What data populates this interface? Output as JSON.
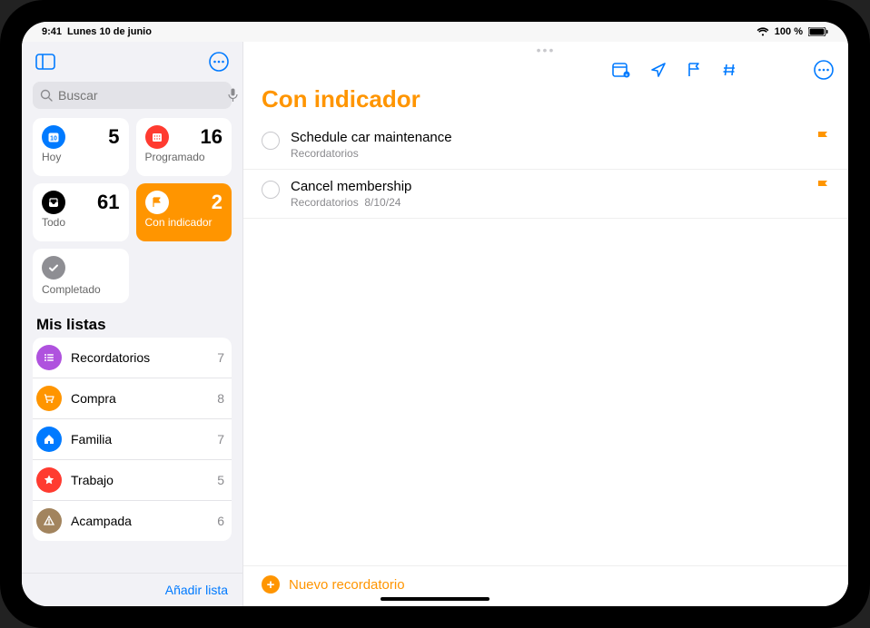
{
  "status": {
    "time": "9:41",
    "date": "Lunes 10 de junio",
    "battery": "100 %"
  },
  "search": {
    "placeholder": "Buscar"
  },
  "smart": {
    "today": {
      "label": "Hoy",
      "count": "5",
      "color": "#007aff"
    },
    "scheduled": {
      "label": "Programado",
      "count": "16",
      "color": "#ff3b30"
    },
    "all": {
      "label": "Todo",
      "count": "61",
      "color": "#000"
    },
    "flagged": {
      "label": "Con indicador",
      "count": "2",
      "color": "#ff9500"
    },
    "completed": {
      "label": "Completado"
    }
  },
  "myLists": {
    "header": "Mis listas",
    "items": [
      {
        "name": "Recordatorios",
        "count": "7",
        "color": "#af52de",
        "icon": "list"
      },
      {
        "name": "Compra",
        "count": "8",
        "color": "#ff9500",
        "icon": "cart"
      },
      {
        "name": "Familia",
        "count": "7",
        "color": "#007aff",
        "icon": "home"
      },
      {
        "name": "Trabajo",
        "count": "5",
        "color": "#ff3b30",
        "icon": "star"
      },
      {
        "name": "Acampada",
        "count": "6",
        "color": "#a2845e",
        "icon": "tent"
      }
    ]
  },
  "sidebarFooter": {
    "addList": "Añadir lista"
  },
  "main": {
    "title": "Con indicador",
    "newReminder": "Nuevo recordatorio",
    "reminders": [
      {
        "title": "Schedule car maintenance",
        "sub": "Recordatorios",
        "date": ""
      },
      {
        "title": "Cancel membership",
        "sub": "Recordatorios",
        "date": "8/10/24"
      }
    ]
  }
}
